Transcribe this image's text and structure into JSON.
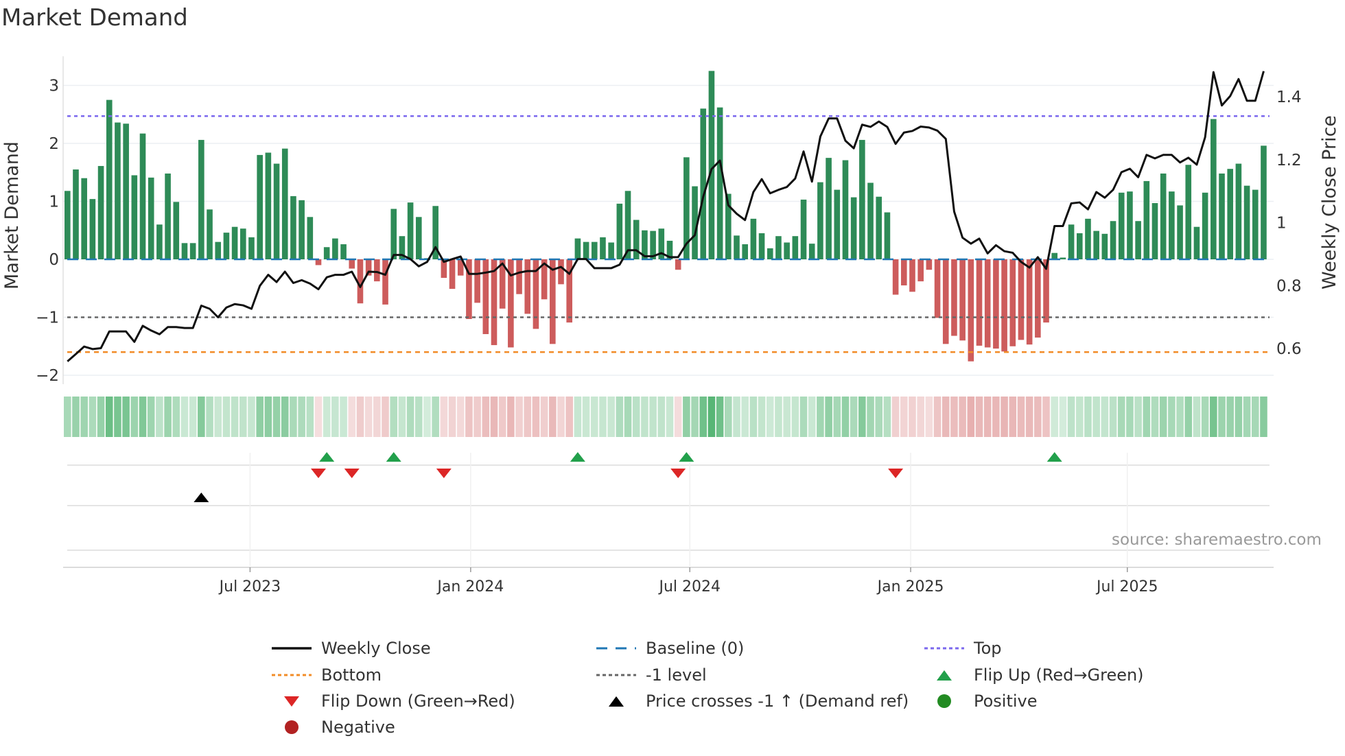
{
  "title": "Market Demand",
  "source": "source: sharemaestro.com",
  "colors": {
    "positive_bar": "#2e8b57",
    "negative_bar": "#cd5c5c",
    "top": "#7b68ee",
    "bottom": "#f28c28",
    "minus_one": "#666666",
    "baseline": "#1f77b4",
    "price": "#111111",
    "flip_up": "#22a04b",
    "flip_down": "#dc2626",
    "cross": "#000000",
    "positive_dot": "#228b22",
    "negative_dot": "#b22222"
  },
  "chart_data": {
    "type": "bar",
    "title": "Market Demand",
    "ylabel": "Market Demand",
    "y2label": "Weekly Close Price",
    "ylim": [
      -2.2,
      3.5
    ],
    "y_ticks": [
      -2,
      -1,
      0,
      1,
      2,
      3
    ],
    "y_tick_labels": [
      "−2",
      "−1",
      "0",
      "1",
      "2",
      "3"
    ],
    "y2_ticks": [
      0.6,
      0.8,
      1.0,
      1.2,
      1.4
    ],
    "y2_tick_labels": [
      "0.6",
      "0.8",
      "1",
      "1.2",
      "1.4"
    ],
    "x_ticks": [
      21.83,
      48.2,
      74.4,
      100.8,
      126.7
    ],
    "x_tick_labels": [
      "Jul 2023",
      "Jan 2024",
      "Jul 2024",
      "Jan 2025",
      "Jul 2025"
    ],
    "levels": {
      "top": 2.47,
      "bottom": -1.6,
      "minus_one": -1,
      "baseline": 0
    },
    "demand": [
      1.18,
      1.55,
      1.4,
      1.04,
      1.61,
      2.75,
      2.36,
      2.34,
      1.45,
      2.17,
      1.41,
      0.6,
      1.48,
      0.99,
      0.28,
      0.28,
      2.06,
      0.86,
      0.3,
      0.46,
      0.56,
      0.53,
      0.38,
      1.8,
      1.84,
      1.65,
      1.91,
      1.09,
      1.02,
      0.73,
      -0.1,
      0.21,
      0.36,
      0.26,
      -0.16,
      -0.76,
      -0.28,
      -0.38,
      -0.78,
      0.87,
      0.4,
      0.98,
      0.73,
      0.02,
      0.92,
      -0.32,
      -0.51,
      -0.28,
      -1.03,
      -0.75,
      -1.29,
      -1.48,
      -0.85,
      -1.52,
      -0.6,
      -0.94,
      -1.2,
      -0.69,
      -1.46,
      -0.43,
      -1.09,
      0.36,
      0.3,
      0.3,
      0.38,
      0.29,
      0.96,
      1.18,
      0.68,
      0.5,
      0.49,
      0.53,
      0.32,
      -0.18,
      1.76,
      1.26,
      2.6,
      3.25,
      2.62,
      1.13,
      0.41,
      0.26,
      0.7,
      0.45,
      0.19,
      0.4,
      0.29,
      0.4,
      1.03,
      0.27,
      1.33,
      1.75,
      1.2,
      1.71,
      1.07,
      2.06,
      1.32,
      1.08,
      0.81,
      -0.61,
      -0.45,
      -0.56,
      -0.38,
      -0.18,
      -1.01,
      -1.46,
      -1.32,
      -1.4,
      -1.76,
      -1.49,
      -1.52,
      -1.54,
      -1.59,
      -1.5,
      -1.39,
      -1.47,
      -1.35,
      -1.09,
      0.11,
      0.03,
      0.6,
      0.45,
      0.7,
      0.49,
      0.44,
      0.66,
      1.15,
      1.17,
      0.66,
      1.35,
      0.97,
      1.48,
      1.17,
      0.93,
      1.63,
      0.56,
      1.15,
      2.42,
      1.48,
      1.56,
      1.65,
      1.27,
      1.2,
      1.96
    ],
    "weekly_close": [
      0.557,
      0.58,
      0.604,
      0.596,
      0.599,
      0.652,
      0.652,
      0.652,
      0.619,
      0.67,
      0.655,
      0.643,
      0.666,
      0.666,
      0.663,
      0.663,
      0.734,
      0.724,
      0.697,
      0.728,
      0.739,
      0.735,
      0.724,
      0.797,
      0.832,
      0.809,
      0.842,
      0.806,
      0.815,
      0.804,
      0.786,
      0.824,
      0.832,
      0.832,
      0.842,
      0.793,
      0.842,
      0.841,
      0.832,
      0.895,
      0.895,
      0.882,
      0.859,
      0.873,
      0.92,
      0.873,
      0.882,
      0.89,
      0.835,
      0.835,
      0.839,
      0.844,
      0.868,
      0.83,
      0.839,
      0.844,
      0.844,
      0.868,
      0.848,
      0.857,
      0.835,
      0.882,
      0.882,
      0.853,
      0.853,
      0.853,
      0.864,
      0.91,
      0.91,
      0.891,
      0.891,
      0.901,
      0.888,
      0.888,
      0.931,
      0.958,
      1.08,
      1.168,
      1.195,
      1.053,
      1.026,
      1.006,
      1.095,
      1.136,
      1.091,
      1.102,
      1.111,
      1.138,
      1.224,
      1.128,
      1.271,
      1.329,
      1.329,
      1.258,
      1.234,
      1.309,
      1.302,
      1.319,
      1.302,
      1.248,
      1.284,
      1.289,
      1.303,
      1.3,
      1.29,
      1.264,
      1.033,
      0.95,
      0.931,
      0.947,
      0.9,
      0.926,
      0.907,
      0.902,
      0.873,
      0.855,
      0.888,
      0.851,
      0.987,
      0.987,
      1.059,
      1.062,
      1.04,
      1.095,
      1.077,
      1.102,
      1.158,
      1.169,
      1.142,
      1.213,
      1.202,
      1.213,
      1.213,
      1.189,
      1.204,
      1.182,
      1.269,
      1.476,
      1.37,
      1.4,
      1.454,
      1.385,
      1.385,
      1.479
    ],
    "y2lim": [
      0.5,
      1.52
    ],
    "flip_up_weeks": [
      31,
      39,
      61,
      74,
      118
    ],
    "flip_down_weeks": [
      30,
      34,
      45,
      73,
      99
    ],
    "price_cross_weeks": [
      16
    ],
    "legend": [
      {
        "label": "Weekly Close",
        "marker": "line"
      },
      {
        "label": "Baseline (0)",
        "marker": "dash"
      },
      {
        "label": "Top",
        "marker": "dot-purple"
      },
      {
        "label": "Bottom",
        "marker": "dot-orange"
      },
      {
        "label": "-1 level",
        "marker": "dot-gray"
      },
      {
        "label": "Flip Up (Red→Green)",
        "marker": "triangle-up-green"
      },
      {
        "label": "Flip Down (Green→Red)",
        "marker": "triangle-down-red"
      },
      {
        "label": "Price crosses -1 ↑ (Demand ref)",
        "marker": "triangle-up-black"
      },
      {
        "label": "Positive",
        "marker": "circle-green"
      },
      {
        "label": "Negative",
        "marker": "circle-red"
      }
    ],
    "legend_placement": "bottom"
  }
}
